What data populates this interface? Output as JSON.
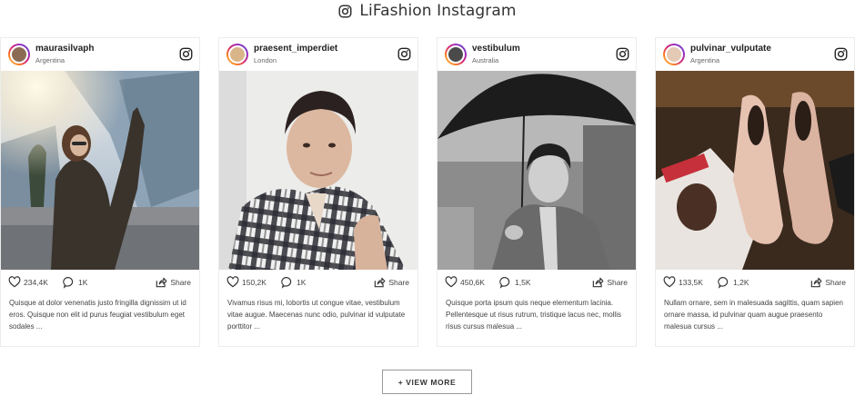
{
  "header": {
    "title": "LiFashion Instagram",
    "icon": "instagram-icon"
  },
  "posts": [
    {
      "username": "maurasilvaph",
      "location": "Argentina",
      "likes": "234,4K",
      "comments": "1K",
      "share_label": "Share",
      "caption": "Quisque at dolor venenatis justo fringilla dignissim ut id eros. Quisque non elit id purus feugiat vestibulum eget sodales ..."
    },
    {
      "username": "praesent_imperdiet",
      "location": "London",
      "likes": "150,2K",
      "comments": "1K",
      "share_label": "Share",
      "caption": "Vivamus risus mi, lobortis ut congue vitae, vestibulum vitae augue. Maecenas nunc odio, pulvinar id vulputate porttitor ..."
    },
    {
      "username": "vestibulum",
      "location": "Australia",
      "likes": "450,6K",
      "comments": "1,5K",
      "share_label": "Share",
      "caption": "Quisque porta ipsum quis neque elementum lacinia. Pellentesque ut risus rutrum, tristique lacus nec, mollis risus cursus malesua ..."
    },
    {
      "username": "pulvinar_vulputate",
      "location": "Argentina",
      "likes": "133,5K",
      "comments": "1,2K",
      "share_label": "Share",
      "caption": "Nullam ornare, sem in malesuada sagittis, quam sapien ornare massa, id pulvinar quam augue praesento malesua cursus ..."
    }
  ],
  "view_more": {
    "label": "+ VIEW MORE"
  }
}
